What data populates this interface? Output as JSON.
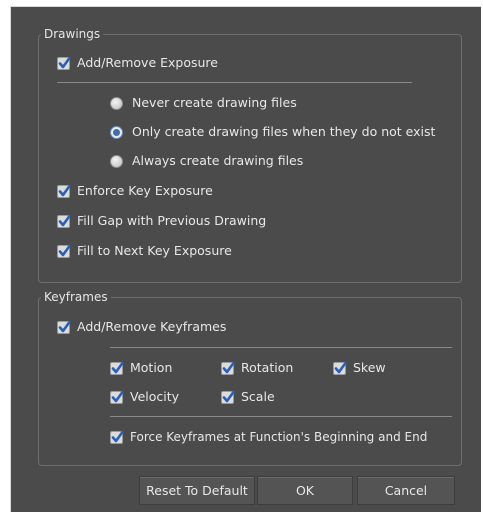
{
  "drawings": {
    "title": "Drawings",
    "add_remove_exposure": "Add/Remove Exposure",
    "radio_options": [
      "Never create drawing files",
      "Only create drawing files when they do not exist",
      "Always create drawing files"
    ],
    "selected_radio": 1,
    "enforce_key_exposure": "Enforce Key Exposure",
    "fill_gap": "Fill Gap with Previous Drawing",
    "fill_to_next": "Fill to Next Key Exposure"
  },
  "keyframes": {
    "title": "Keyframes",
    "add_remove_keyframes": "Add/Remove Keyframes",
    "motion": "Motion",
    "rotation": "Rotation",
    "skew": "Skew",
    "velocity": "Velocity",
    "scale": "Scale",
    "force_keyframes": "Force Keyframes at Function's Beginning and End"
  },
  "buttons": {
    "reset": "Reset To Default",
    "ok": "OK",
    "cancel": "Cancel"
  },
  "colors": {
    "dialog_bg": "#4b4b4b",
    "check_blue": "#2b5fb5",
    "radio_selected": "#3d6fb0"
  }
}
